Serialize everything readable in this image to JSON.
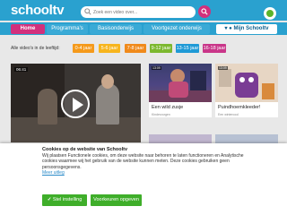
{
  "header": {
    "logo_prefix": "school",
    "logo_suffix": "tv",
    "search_placeholder": "Zoek een video over...",
    "user_label": "Mijn Schooltv"
  },
  "nav": {
    "home": "Home",
    "programmas": "Programma's",
    "basisonderwijs": "Basisonderwijs",
    "voortgezet": "Voortgezet onderwijs",
    "user": "▾  ● Mijn Schooltv"
  },
  "agebar": {
    "label": "Alle video's in de leeftijd:",
    "buttons": [
      "0-4 jaar",
      "5-6 jaar",
      "7-8 jaar",
      "9-12 jaar",
      "13-15 jaar",
      "16-18 jaar"
    ],
    "colors": [
      "#f59a1b",
      "#f7b51d",
      "#f08a1b",
      "#7cb82f",
      "#1f9ad6",
      "#c93689"
    ]
  },
  "video": {
    "badge": "06:41"
  },
  "cards": [
    {
      "title": "Een wild zusje",
      "meta": "Kinderzorgen",
      "badge": "13:09"
    },
    {
      "title": "Puindhoemkleeder!",
      "meta": "Een wintercool",
      "badge": "13:09"
    }
  ],
  "cookie": {
    "title": "Cookies op de website van Schooltv",
    "body": "Wij plaatsen Functionele cookies, om deze website naar behoren te laten functioneren en Analytische cookies waarmee wij het gebruik van de website kunnen meten. Deze cookies gebruiken geen persoonsgegevens.",
    "link": "Meer uitleg",
    "btn_settings": "Stel instelling",
    "btn_accept": "Voorkeuren opgeven"
  }
}
